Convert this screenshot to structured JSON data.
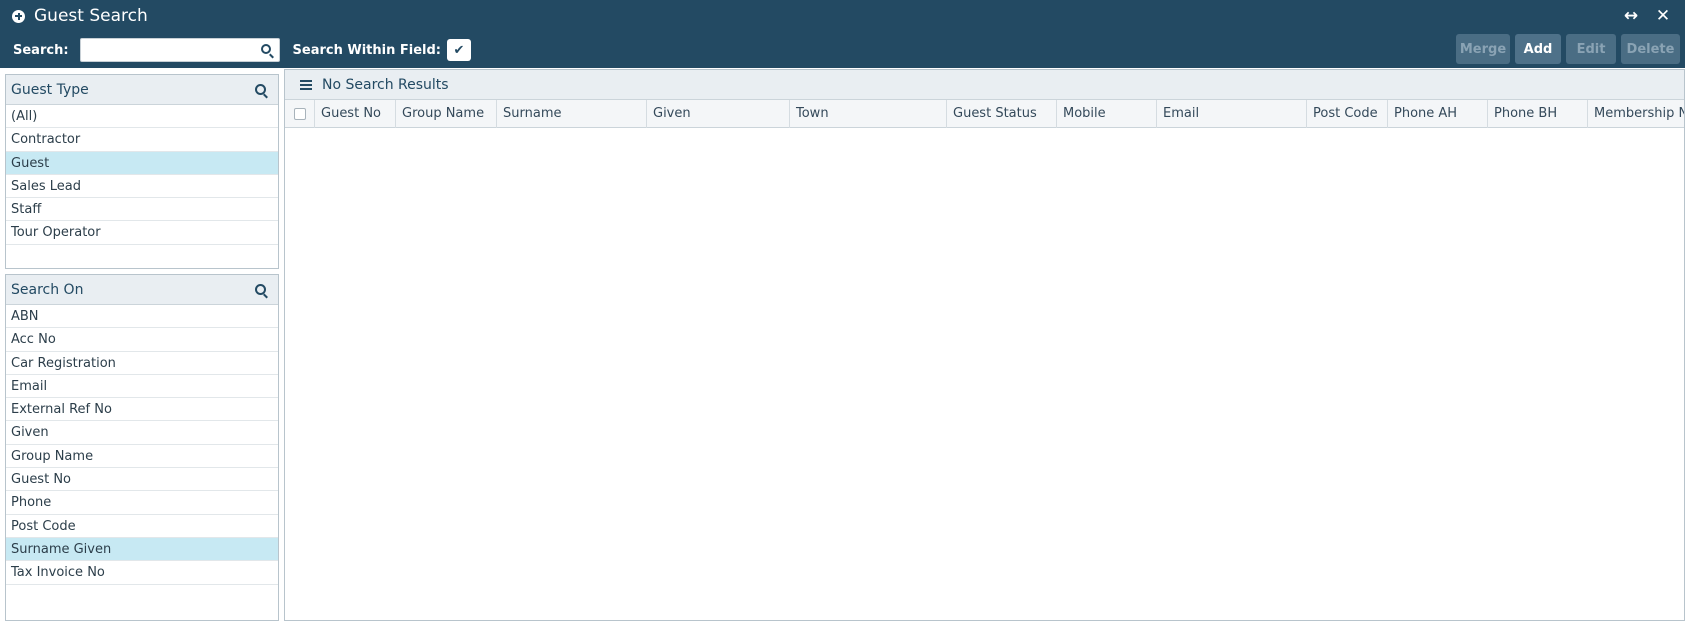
{
  "window": {
    "title": "Guest Search",
    "expand_icon": "↔",
    "close_icon": "✕"
  },
  "search": {
    "label": "Search:",
    "value": "",
    "placeholder": "",
    "within_field_label": "Search Within Field:",
    "within_field_checked": true
  },
  "actions": {
    "merge": "Merge",
    "add": "Add",
    "edit": "Edit",
    "delete": "Delete"
  },
  "guest_type": {
    "title": "Guest Type",
    "items": [
      "(All)",
      "Contractor",
      "Guest",
      "Sales Lead",
      "Staff",
      "Tour Operator"
    ],
    "selected": "Guest"
  },
  "search_on": {
    "title": "Search On",
    "items": [
      "ABN",
      "Acc No",
      "Car Registration",
      "Email",
      "External Ref No",
      "Given",
      "Group Name",
      "Guest No",
      "Phone",
      "Post Code",
      "Surname Given",
      "Tax Invoice No"
    ],
    "selected": "Surname Given"
  },
  "results": {
    "title": "No Search Results",
    "columns": [
      "Guest No",
      "Group Name",
      "Surname",
      "Given",
      "Town",
      "Guest Status",
      "Mobile",
      "Email",
      "Post Code",
      "Phone AH",
      "Phone BH",
      "Membership No"
    ]
  },
  "colors": {
    "header_bg": "#234a63",
    "selected_row": "#c7e9f3",
    "panel_head_bg": "#e9eef2"
  }
}
